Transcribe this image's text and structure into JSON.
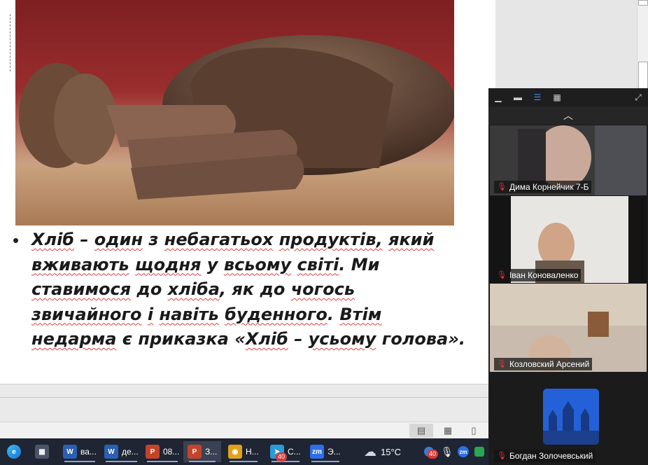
{
  "slide": {
    "bullet": "•",
    "segments": [
      {
        "text": "Хліб",
        "spell": true
      },
      {
        "text": " – ",
        "spell": false
      },
      {
        "text": "один",
        "spell": true
      },
      {
        "text": " з ",
        "spell": false
      },
      {
        "text": "небагатьох",
        "spell": true
      },
      {
        "text": " ",
        "spell": false
      },
      {
        "text": "продуктів,",
        "spell": true
      },
      {
        "text": " ",
        "spell": false
      },
      {
        "text": "який",
        "spell": true
      },
      {
        "text": " ",
        "spell": false
      },
      {
        "text": "вживають",
        "spell": true
      },
      {
        "text": " ",
        "spell": false
      },
      {
        "text": "щодня",
        "spell": true
      },
      {
        "text": " у ",
        "spell": false
      },
      {
        "text": "всьому",
        "spell": true
      },
      {
        "text": " ",
        "spell": false
      },
      {
        "text": "світі",
        "spell": true
      },
      {
        "text": ". Ми ",
        "spell": false
      },
      {
        "text": "ставимося",
        "spell": true
      },
      {
        "text": " до ",
        "spell": false
      },
      {
        "text": "хліба",
        "spell": true
      },
      {
        "text": ", як до ",
        "spell": false
      },
      {
        "text": "чогось",
        "spell": true
      },
      {
        "text": " ",
        "spell": false
      },
      {
        "text": "звичайного",
        "spell": true
      },
      {
        "text": " ",
        "spell": false
      },
      {
        "text": "і",
        "spell": true
      },
      {
        "text": " ",
        "spell": false
      },
      {
        "text": "навіть",
        "spell": true
      },
      {
        "text": " ",
        "spell": false
      },
      {
        "text": "буденного",
        "spell": true
      },
      {
        "text": ". ",
        "spell": false
      },
      {
        "text": "Втім",
        "spell": true
      },
      {
        "text": " ",
        "spell": false
      },
      {
        "text": "недарма",
        "spell": true
      },
      {
        "text": " є приказка «",
        "spell": false
      },
      {
        "text": "Хліб",
        "spell": true
      },
      {
        "text": " – ",
        "spell": false
      },
      {
        "text": "усьому",
        "spell": true
      },
      {
        "text": " голова».",
        "spell": false
      }
    ]
  },
  "zoom": {
    "participants": [
      {
        "name": "Дима Корнейчик 7-Б"
      },
      {
        "name": "Іван Коноваленко"
      },
      {
        "name": "Козловский Арсений"
      },
      {
        "name": "Богдан Золочевський"
      }
    ]
  },
  "taskbar": {
    "items": [
      {
        "label": "ва...",
        "icon": "W",
        "color": "#2b5fb4"
      },
      {
        "label": "де...",
        "icon": "W",
        "color": "#2b5fb4"
      },
      {
        "label": "08...",
        "icon": "P",
        "color": "#c4432b"
      },
      {
        "label": "З...",
        "icon": "P",
        "color": "#c4432b"
      },
      {
        "label": "Н...",
        "icon": "◉",
        "color": "#e0a21a"
      },
      {
        "label": "С...",
        "icon": "➤",
        "color": "#2a9ad8"
      },
      {
        "label": "Э...",
        "icon": "zm",
        "color": "#2d6fe8"
      }
    ],
    "telegram_badge": "40",
    "tray_badge": "40",
    "temperature": "15°C"
  },
  "colors": {
    "taskbar": "#1f2533",
    "spell_underline": "#e23a3a",
    "zoom_bg": "#1c1c1c"
  }
}
